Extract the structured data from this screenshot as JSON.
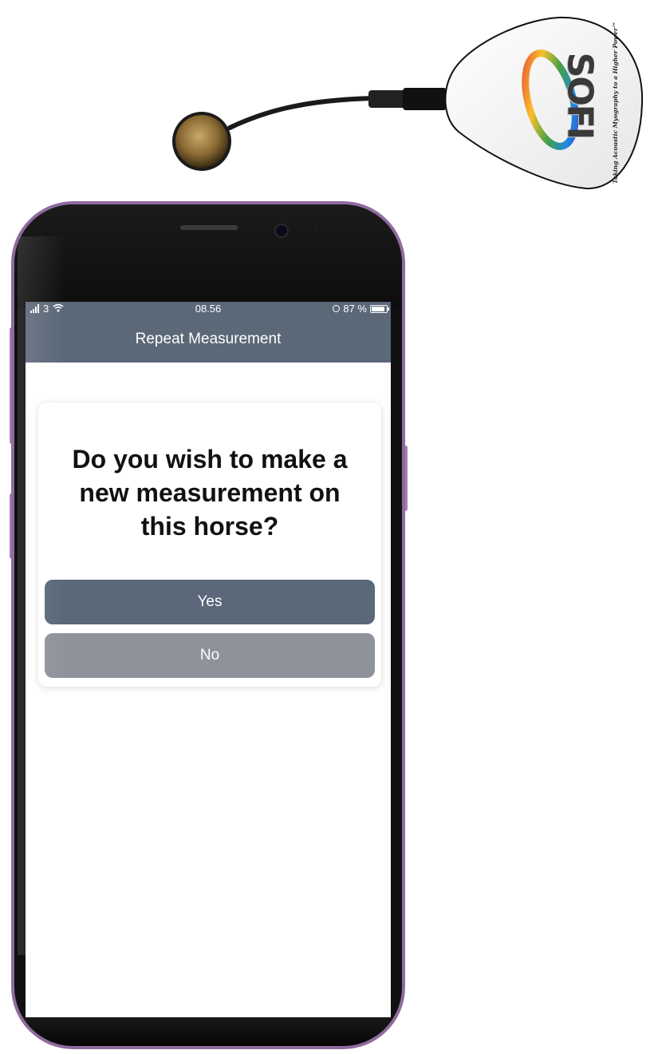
{
  "sensor": {
    "logo_text": "SOFI",
    "tagline": "Taking Acoustic Myography to a Higher Power™"
  },
  "status_bar": {
    "carrier": "3",
    "time": "08.56",
    "battery": "87 %",
    "battery_level": 0.87,
    "icons": [
      "signal-icon",
      "wifi-icon",
      "orientation-lock-icon",
      "battery-icon"
    ]
  },
  "nav": {
    "title": "Repeat Measurement"
  },
  "dialog": {
    "question": "Do you wish to make a new measurement on this horse?",
    "yes_label": "Yes",
    "no_label": "No"
  },
  "colors": {
    "header": "#5b6878",
    "yes_button": "#5a6879",
    "no_button": "#8e939b",
    "phone_frame": "#8f6a9f"
  }
}
